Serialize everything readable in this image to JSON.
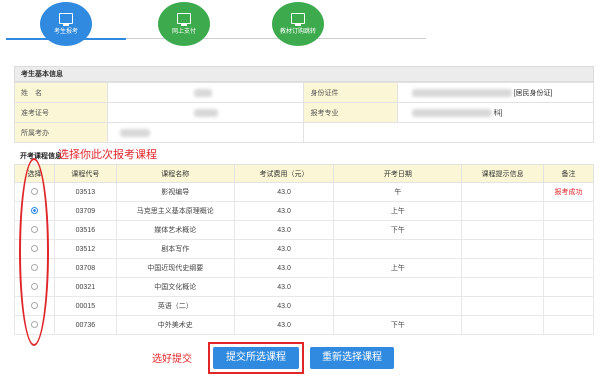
{
  "steps": [
    {
      "label": "考生报考",
      "active": true
    },
    {
      "label": "网上支付",
      "active": false
    },
    {
      "label": "教材订购跳转",
      "active": false
    }
  ],
  "info": {
    "title": "考生基本信息",
    "name_label": "姓　名",
    "id_label": "身份证件",
    "id_type": "[居民身份证]",
    "ticket_label": "准考证号",
    "major_label": "报考专业",
    "major_suffix": "科]",
    "office_label": "所属考办"
  },
  "course": {
    "title": "开考课程信息",
    "hint": "选择你此次报考课程",
    "headers": [
      "选择",
      "课程代号",
      "课程名称",
      "考试费用（元）",
      "开考日期",
      "课程提示信息",
      "备注"
    ],
    "rows": [
      {
        "code": "03513",
        "name": "影视编导",
        "fee": "43.0",
        "date": "午",
        "note": "",
        "remark": "报考成功",
        "selected": false
      },
      {
        "code": "03709",
        "name": "马克思主义基本原理概论",
        "fee": "43.0",
        "date": "上午",
        "note": "",
        "remark": "",
        "selected": true
      },
      {
        "code": "03516",
        "name": "媒体艺术概论",
        "fee": "43.0",
        "date": "下午",
        "note": "",
        "remark": "",
        "selected": false
      },
      {
        "code": "03512",
        "name": "剧本写作",
        "fee": "43.0",
        "date": "",
        "note": "",
        "remark": "",
        "selected": false
      },
      {
        "code": "03708",
        "name": "中国近现代史纲要",
        "fee": "43.0",
        "date": "上午",
        "note": "",
        "remark": "",
        "selected": false
      },
      {
        "code": "00321",
        "name": "中国文化概论",
        "fee": "43.0",
        "date": "",
        "note": "",
        "remark": "",
        "selected": false
      },
      {
        "code": "00015",
        "name": "英语（二）",
        "fee": "43.0",
        "date": "",
        "note": "",
        "remark": "",
        "selected": false
      },
      {
        "code": "00736",
        "name": "中外美术史",
        "fee": "43.0",
        "date": "下午",
        "note": "",
        "remark": "",
        "selected": false
      }
    ]
  },
  "bottom": {
    "hint": "选好提交",
    "submit": "提交所选课程",
    "reset": "重新选择课程"
  },
  "colors": {
    "accent": "#2f8ae0",
    "green": "#3daa4e",
    "red": "#e0262a",
    "label_bg": "#fbf7d6"
  }
}
